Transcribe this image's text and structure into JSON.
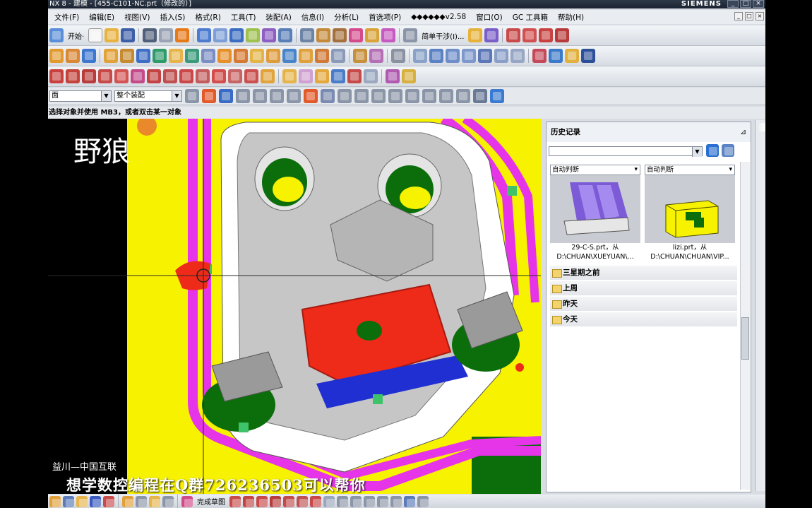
{
  "window": {
    "title": "NX 8 - 建模 - [455-C101-NC.prt（修改的）]",
    "brand": "SIEMENS",
    "controls": [
      "_",
      "□",
      "×"
    ]
  },
  "menu": {
    "items": [
      "文件(F)",
      "编辑(E)",
      "视图(V)",
      "插入(S)",
      "格式(R)",
      "工具(T)",
      "装配(A)",
      "信息(I)",
      "分析(L)",
      "首选项(P)",
      "◆◆◆◆◆◆v2.58",
      "窗口(O)",
      "GC 工具箱",
      "帮助(H)"
    ],
    "mdi_controls": [
      "_",
      "□",
      "×"
    ]
  },
  "toolbar": {
    "start_label": "开始·",
    "simple_interference_label": "简单干涉(I)..."
  },
  "selection_bar": {
    "filter_value": "面",
    "scope_value": "整个装配"
  },
  "cue_line": "选择对象并使用 MB3，或者双击某一对象",
  "viewport": {
    "watermark": "野狼",
    "subtext": "益川—中国互联",
    "caption": "想学数控编程在Q群726236503可以帮你"
  },
  "history": {
    "title": "历史记录",
    "pin_glyph": "⊿",
    "search_value": "",
    "thumbnails": [
      {
        "mode": "自动判断",
        "name": "29-C-S.prt，从",
        "path": "D:\\CHUAN\\XUEYUAN\\..."
      },
      {
        "mode": "自动判断",
        "name": "lizi.prt，从",
        "path": "D:\\CHUAN\\CHUAN\\VIP..."
      }
    ],
    "groups": [
      "三星期之前",
      "上周",
      "昨天",
      "今天"
    ]
  },
  "status": {
    "sketch_label": "完成草图"
  },
  "colors": {
    "part_yellow": "#f7f200",
    "part_magenta": "#e634e8",
    "part_green": "#0b6e0b",
    "part_red": "#ee2a18",
    "part_blue": "#1f2fd1",
    "part_gray": "#c6c6c6",
    "accent_orange": "#e9892a"
  }
}
